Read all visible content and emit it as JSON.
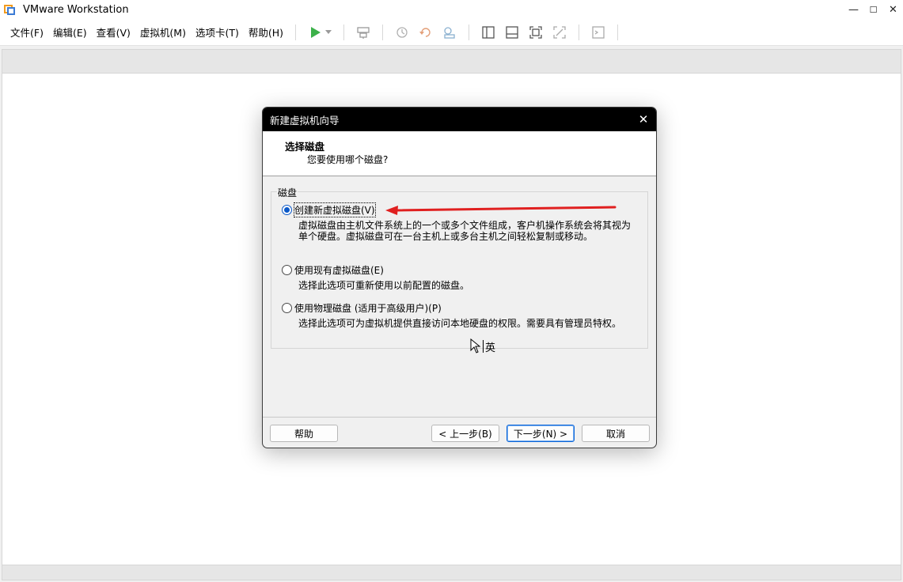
{
  "window": {
    "title": "VMware Workstation",
    "minimize": "—",
    "maximize": "☐",
    "close": "✕"
  },
  "menu": {
    "items": [
      "文件(F)",
      "编辑(E)",
      "查看(V)",
      "虚拟机(M)",
      "选项卡(T)",
      "帮助(H)"
    ]
  },
  "toolbar": {
    "icons": [
      "play-icon",
      "dropdown-arrow-icon",
      "send-keys-icon",
      "snapshot-icon",
      "revert-snapshot-icon",
      "manage-snapshots-icon",
      "show-library-icon",
      "thumbnail-bar-icon",
      "fullscreen-icon",
      "unity-icon",
      "console-icon"
    ],
    "play_color": "#3cb14a"
  },
  "dialog": {
    "title": "新建虚拟机向导",
    "close": "✕",
    "header_title": "选择磁盘",
    "header_subtitle": "您要使用哪个磁盘?",
    "group_label": "磁盘",
    "options": [
      {
        "label": "创建新虚拟磁盘(V)",
        "checked": true,
        "description": [
          "虚拟磁盘由主机文件系统上的一个或多个文件组成，客户机操作系统会将其视为",
          "单个硬盘。虚拟磁盘可在一台主机上或多台主机之间轻松复制或移动。"
        ]
      },
      {
        "label": "使用现有虚拟磁盘(E)",
        "checked": false,
        "description": [
          "选择此选项可重新使用以前配置的磁盘。"
        ]
      },
      {
        "label": "使用物理磁盘 (适用于高级用户)(P)",
        "checked": false,
        "description": [
          "选择此选项可为虚拟机提供直接访问本地硬盘的权限。需要具有管理员特权。"
        ]
      }
    ],
    "buttons": {
      "help": "帮助",
      "back": "< 上一步(B)",
      "next": "下一步(N) >",
      "cancel": "取消"
    }
  },
  "annotation": {
    "arrow_color": "#e02020"
  },
  "ime": {
    "text": "英"
  }
}
